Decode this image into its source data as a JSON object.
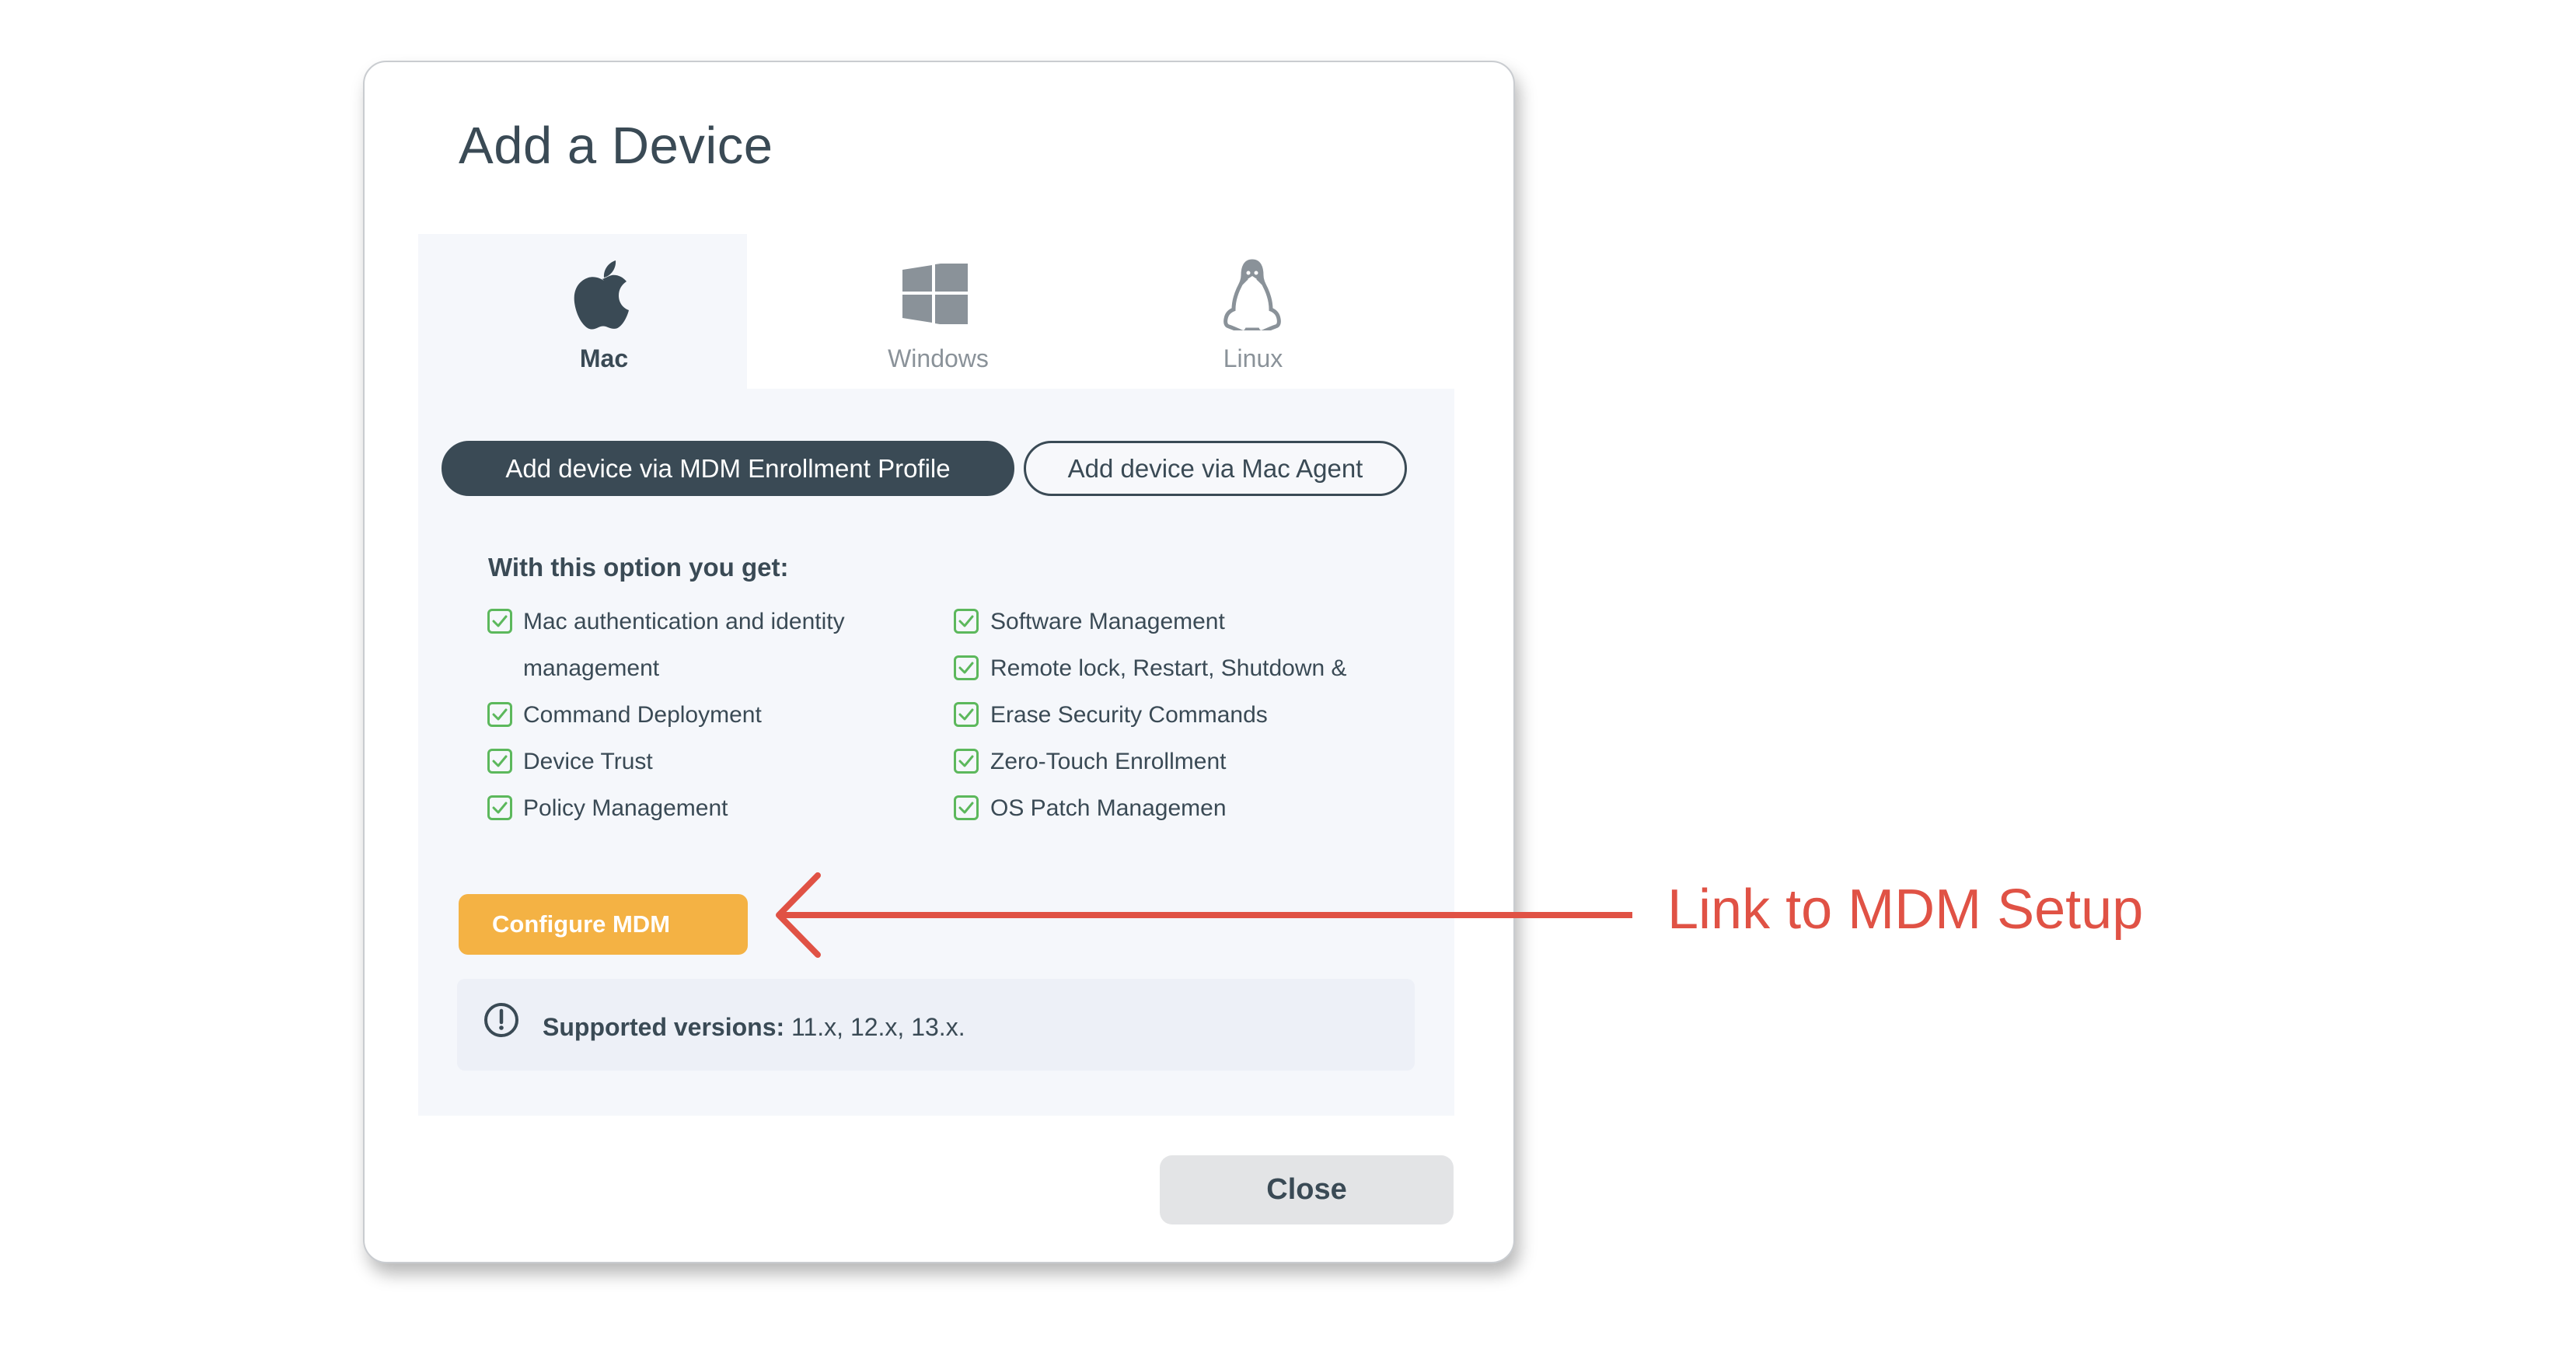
{
  "dialog": {
    "title": "Add a Device",
    "tabs": [
      {
        "label": "Mac",
        "icon": "apple-icon",
        "active": true
      },
      {
        "label": "Windows",
        "icon": "windows-icon",
        "active": false
      },
      {
        "label": "Linux",
        "icon": "linux-penguin-icon",
        "active": false
      }
    ],
    "options": {
      "mdm_profile_label": "Add device via MDM Enrollment Profile",
      "mac_agent_label": "Add device via Mac Agent",
      "selected": "mdm_profile"
    },
    "features": {
      "heading": "With this option you get:",
      "left": [
        {
          "lines": [
            "Mac authentication and identity",
            "management"
          ]
        },
        {
          "lines": [
            "Command Deployment"
          ]
        },
        {
          "lines": [
            "Device Trust"
          ]
        },
        {
          "lines": [
            "Policy Management"
          ]
        }
      ],
      "right": [
        {
          "lines": [
            "Software Management"
          ]
        },
        {
          "lines": [
            "Remote lock, Restart, Shutdown &"
          ]
        },
        {
          "lines": [
            "Erase Security Commands"
          ]
        },
        {
          "lines": [
            "Zero-Touch Enrollment"
          ]
        },
        {
          "lines": [
            "OS Patch Managemen"
          ]
        }
      ]
    },
    "configure_button": "Configure MDM",
    "info": {
      "icon": "exclamation-circle-icon",
      "label": "Supported versions:",
      "value": " 11.x, 12.x, 13.x."
    },
    "close_button": "Close"
  },
  "annotation": {
    "label": "Link to MDM Setup",
    "color": "#e05245"
  },
  "colors": {
    "primary_dark": "#3a4a55",
    "accent_orange": "#f4b244",
    "check_green": "#5cb85c",
    "panel_bg": "#f5f7fb",
    "info_bg": "#edf0f7",
    "inactive_icon": "#8a9299"
  }
}
